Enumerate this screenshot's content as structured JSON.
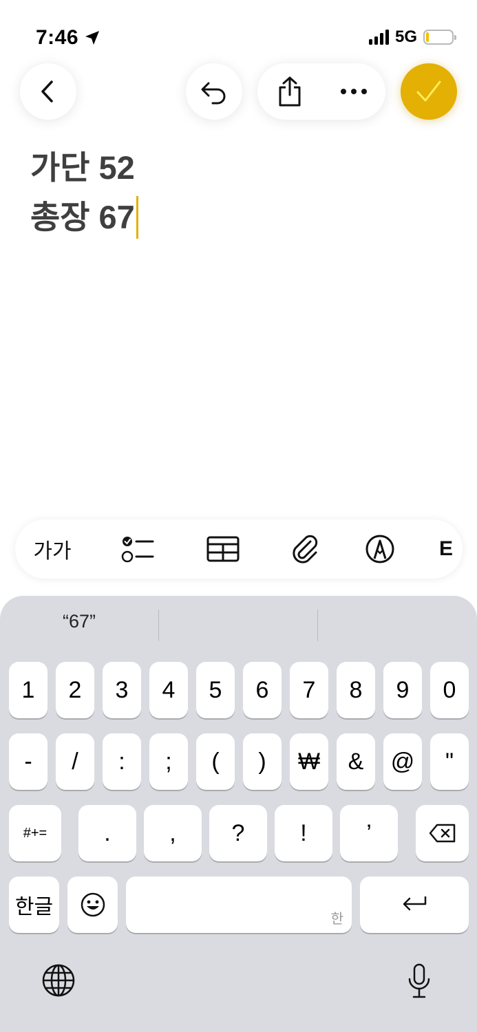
{
  "status": {
    "time": "7:46",
    "network": "5G"
  },
  "note": {
    "lines": [
      "가단 52",
      "총장 67"
    ]
  },
  "toolbar": {
    "text_style_label": "가가",
    "more_hint": "E"
  },
  "keyboard": {
    "prediction": "“67”",
    "row1": [
      "1",
      "2",
      "3",
      "4",
      "5",
      "6",
      "7",
      "8",
      "9",
      "0"
    ],
    "row2": [
      "-",
      "/",
      ":",
      ";",
      "(",
      ")",
      "₩",
      "&",
      "@",
      "\""
    ],
    "row3": [
      "#+=",
      ".",
      ",",
      "?",
      "!",
      "’"
    ],
    "row4": {
      "lang": "한글",
      "space_hint": "한"
    }
  },
  "colors": {
    "accent": "#e3b003",
    "keyboard_bg": "#d9dbe0"
  }
}
